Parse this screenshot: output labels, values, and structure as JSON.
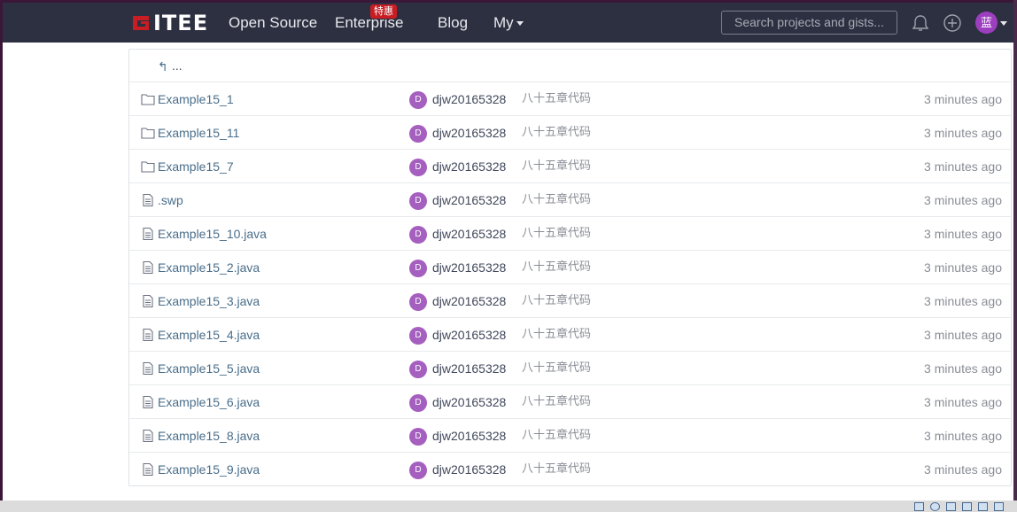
{
  "navbar": {
    "logo_text": "ITEE",
    "items": [
      {
        "label": "Open Source"
      },
      {
        "label": "Enterprise",
        "badge": "特惠"
      },
      {
        "label": "Blog"
      },
      {
        "label": "My"
      }
    ],
    "search_placeholder": "Search projects and gists...",
    "avatar_text": "蓝"
  },
  "file_list": {
    "back_label": "...",
    "rows": [
      {
        "type": "folder",
        "name": "Example15_1",
        "avatar": "D",
        "author": "djw20165328",
        "message": "八十五章代码",
        "time": "3 minutes ago"
      },
      {
        "type": "folder",
        "name": "Example15_11",
        "avatar": "D",
        "author": "djw20165328",
        "message": "八十五章代码",
        "time": "3 minutes ago"
      },
      {
        "type": "folder",
        "name": "Example15_7",
        "avatar": "D",
        "author": "djw20165328",
        "message": "八十五章代码",
        "time": "3 minutes ago"
      },
      {
        "type": "file",
        "name": ".swp",
        "avatar": "D",
        "author": "djw20165328",
        "message": "八十五章代码",
        "time": "3 minutes ago"
      },
      {
        "type": "file",
        "name": "Example15_10.java",
        "avatar": "D",
        "author": "djw20165328",
        "message": "八十五章代码",
        "time": "3 minutes ago"
      },
      {
        "type": "file",
        "name": "Example15_2.java",
        "avatar": "D",
        "author": "djw20165328",
        "message": "八十五章代码",
        "time": "3 minutes ago"
      },
      {
        "type": "file",
        "name": "Example15_3.java",
        "avatar": "D",
        "author": "djw20165328",
        "message": "八十五章代码",
        "time": "3 minutes ago"
      },
      {
        "type": "file",
        "name": "Example15_4.java",
        "avatar": "D",
        "author": "djw20165328",
        "message": "八十五章代码",
        "time": "3 minutes ago"
      },
      {
        "type": "file",
        "name": "Example15_5.java",
        "avatar": "D",
        "author": "djw20165328",
        "message": "八十五章代码",
        "time": "3 minutes ago"
      },
      {
        "type": "file",
        "name": "Example15_6.java",
        "avatar": "D",
        "author": "djw20165328",
        "message": "八十五章代码",
        "time": "3 minutes ago"
      },
      {
        "type": "file",
        "name": "Example15_8.java",
        "avatar": "D",
        "author": "djw20165328",
        "message": "八十五章代码",
        "time": "3 minutes ago"
      },
      {
        "type": "file",
        "name": "Example15_9.java",
        "avatar": "D",
        "author": "djw20165328",
        "message": "八十五章代码",
        "time": "3 minutes ago"
      }
    ]
  },
  "colors": {
    "navbar_bg": "#2c3041",
    "brand_red": "#c71d23",
    "link": "#4a6e8a",
    "avatar_purple": "#a55fbf"
  },
  "icons": {
    "folder": "folder-icon",
    "file": "file-icon",
    "bell": "bell-icon",
    "plus": "plus-circle-icon",
    "back": "reply-arrow-icon"
  }
}
